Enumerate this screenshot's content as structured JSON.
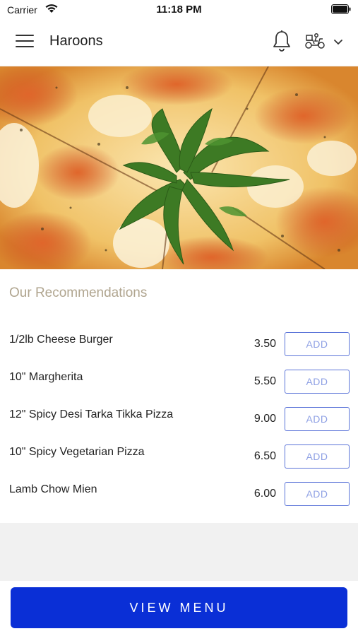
{
  "status_bar": {
    "carrier": "Carrier",
    "time": "11:18 PM"
  },
  "header": {
    "title": "Haroons",
    "icons": [
      "menu-icon",
      "bell-icon",
      "delivery-scooter-icon",
      "chevron-down-icon"
    ]
  },
  "hero": {
    "image": "pizza with arugula"
  },
  "recommendations": {
    "title": "Our Recommendations",
    "items": [
      {
        "name": "1/2lb Cheese Burger",
        "price": "3.50",
        "add_label": "ADD"
      },
      {
        "name": "10\" Margherita",
        "price": "5.50",
        "add_label": "ADD"
      },
      {
        "name": "12\" Spicy Desi Tarka Tikka Pizza",
        "price": "9.00",
        "add_label": "ADD"
      },
      {
        "name": "10\" Spicy Vegetarian Pizza",
        "price": "6.50",
        "add_label": "ADD"
      },
      {
        "name": "Lamb Chow Mien",
        "price": "6.00",
        "add_label": "ADD"
      }
    ]
  },
  "footer": {
    "view_menu_label": "VIEW MENU"
  },
  "colors": {
    "primary": "#0a2fd6",
    "add_border": "#5a73d8",
    "section_title": "#b0a58f"
  }
}
